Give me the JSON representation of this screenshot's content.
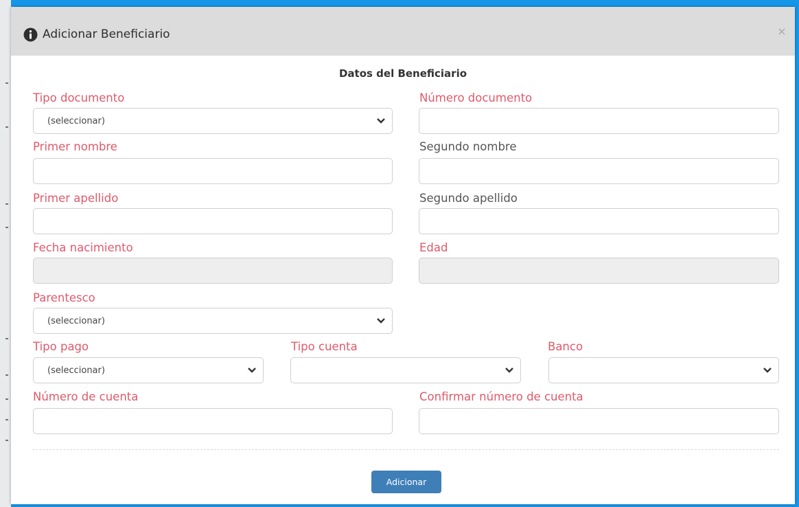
{
  "modal": {
    "title": "Adicionar Beneficiario",
    "close_label": "×",
    "section_title": "Datos del Beneficiario"
  },
  "fields": {
    "tipo_documento": {
      "label": "Tipo documento",
      "value": "(seleccionar)"
    },
    "numero_documento": {
      "label": "Número documento",
      "value": ""
    },
    "primer_nombre": {
      "label": "Primer nombre",
      "value": ""
    },
    "segundo_nombre": {
      "label": "Segundo nombre",
      "value": ""
    },
    "primer_apellido": {
      "label": "Primer apellido",
      "value": ""
    },
    "segundo_apellido": {
      "label": "Segundo apellido",
      "value": ""
    },
    "fecha_nacimiento": {
      "label": "Fecha nacimiento",
      "value": ""
    },
    "edad": {
      "label": "Edad",
      "value": ""
    },
    "parentesco": {
      "label": "Parentesco",
      "value": "(seleccionar)"
    },
    "tipo_pago": {
      "label": "Tipo pago",
      "value": "(seleccionar)"
    },
    "tipo_cuenta": {
      "label": "Tipo cuenta",
      "value": ""
    },
    "banco": {
      "label": "Banco",
      "value": ""
    },
    "numero_cuenta": {
      "label": "Número de cuenta",
      "value": ""
    },
    "confirmar_numero_cuenta": {
      "label": "Confirmar número de cuenta",
      "value": ""
    }
  },
  "actions": {
    "submit_label": "Adicionar"
  },
  "colors": {
    "backdrop_border": "#1596e8",
    "header_bg": "#dcdcdc",
    "required_label": "#e05a6a",
    "optional_label": "#555555",
    "button_bg": "#3f7fb8",
    "disabled_field_bg": "#eeeeee"
  },
  "icons": {
    "title_icon": "info-circle-icon",
    "select_indicator": "chevron-down-icon"
  }
}
